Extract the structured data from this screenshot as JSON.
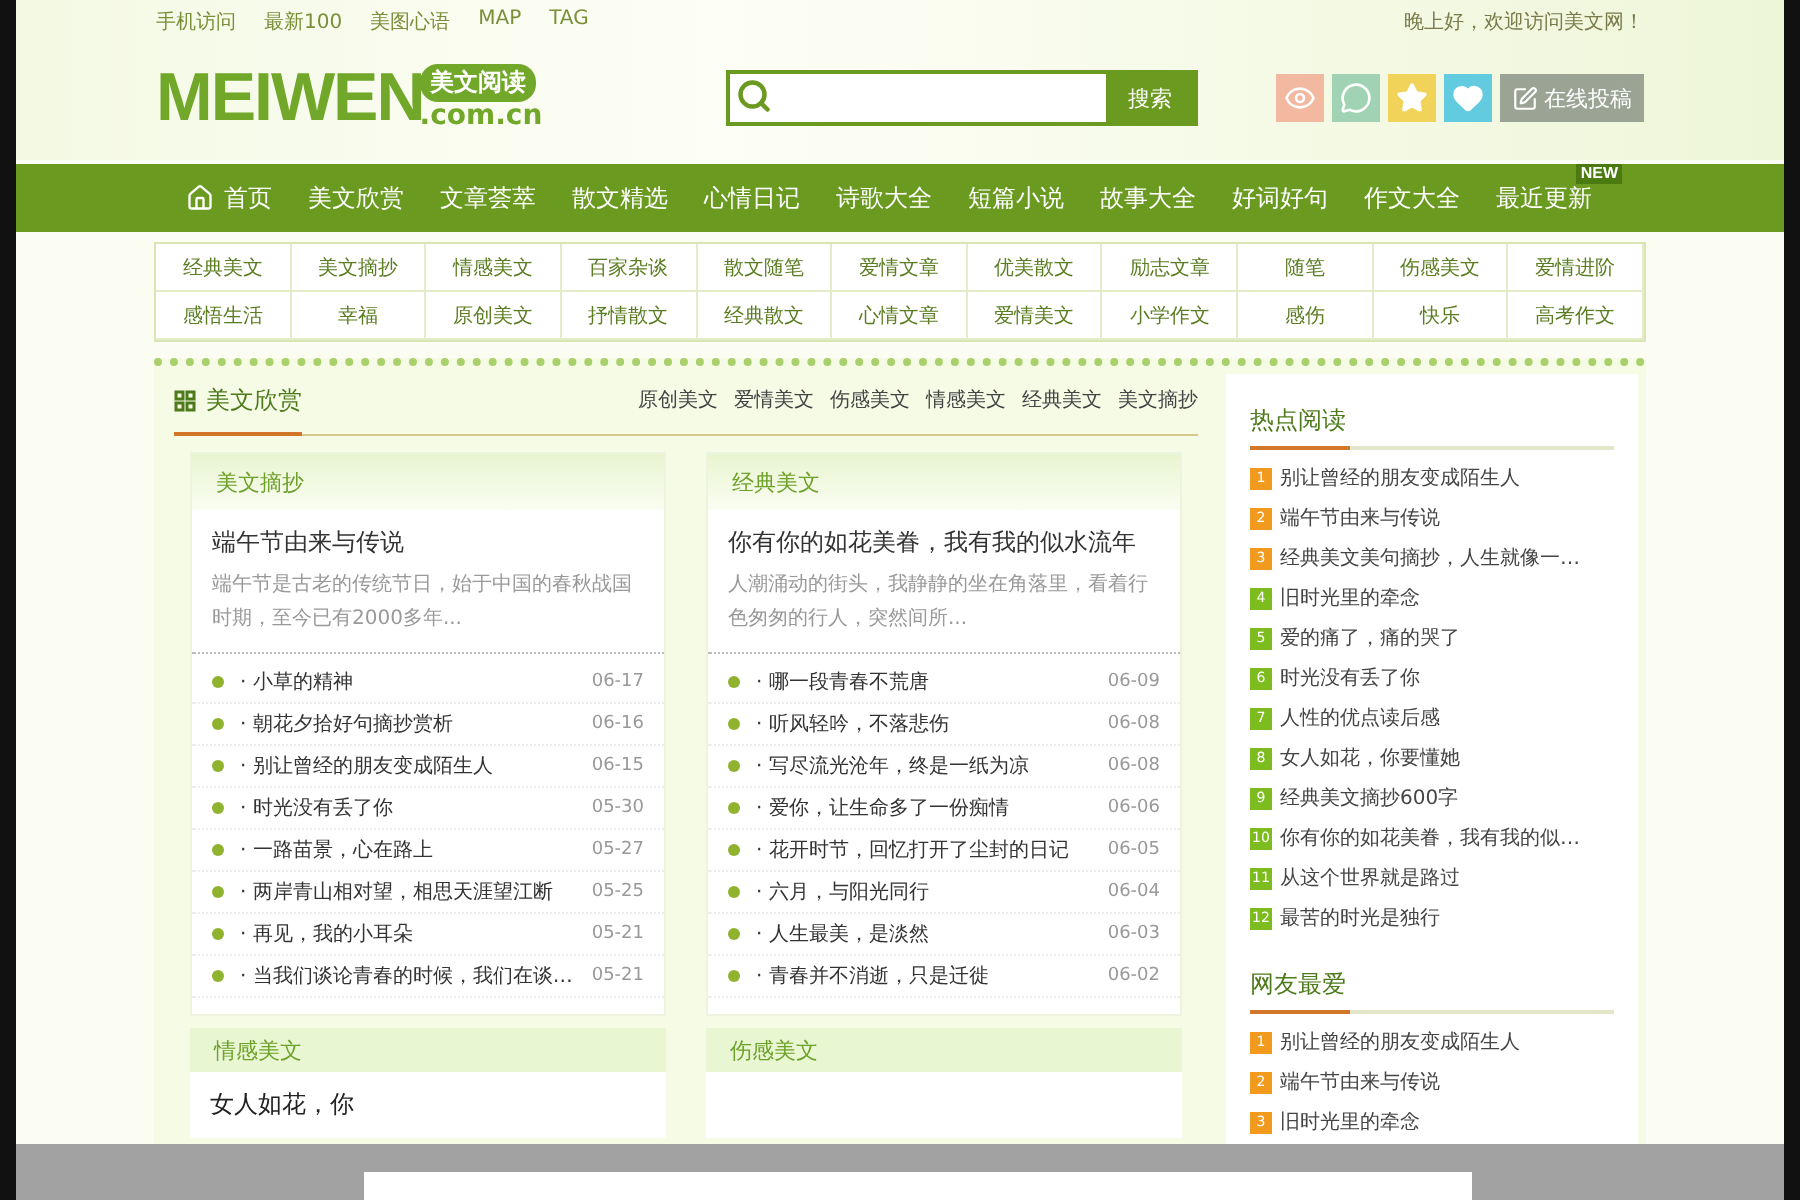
{
  "top_links": [
    "手机访问",
    "最新100",
    "美图心语",
    "MAP",
    "TAG"
  ],
  "greeting": "晚上好，欢迎访问美文网！",
  "logo": {
    "wordmark": "MEIWEN",
    "badge": "美文阅读",
    "domain": ".com.cn"
  },
  "search": {
    "button": "搜索"
  },
  "submit_button": "在线投稿",
  "nav": [
    {
      "label": "首页",
      "kind": "home"
    },
    {
      "label": "美文欣赏",
      "kind": "plain"
    },
    {
      "label": "文章荟萃",
      "kind": "plain"
    },
    {
      "label": "散文精选",
      "kind": "plain"
    },
    {
      "label": "心情日记",
      "kind": "plain"
    },
    {
      "label": "诗歌大全",
      "kind": "plain"
    },
    {
      "label": "短篇小说",
      "kind": "plain"
    },
    {
      "label": "故事大全",
      "kind": "plain"
    },
    {
      "label": "好词好句",
      "kind": "plain"
    },
    {
      "label": "作文大全",
      "kind": "plain"
    },
    {
      "label": "最近更新",
      "kind": "new",
      "badge": "NEW"
    }
  ],
  "categories": [
    [
      "经典美文",
      "美文摘抄",
      "情感美文",
      "百家杂谈",
      "散文随笔",
      "爱情文章",
      "优美散文",
      "励志文章",
      "随笔",
      "伤感美文",
      "爱情进阶"
    ],
    [
      "感悟生活",
      "幸福",
      "原创美文",
      "抒情散文",
      "经典散文",
      "心情文章",
      "爱情美文",
      "小学作文",
      "感伤",
      "快乐",
      "高考作文"
    ]
  ],
  "section": {
    "title": "美文欣赏",
    "tabs": [
      "原创美文",
      "爱情美文",
      "伤感美文",
      "情感美文",
      "经典美文",
      "美文摘抄"
    ]
  },
  "cards": [
    {
      "title": "美文摘抄",
      "lead": "端午节由来与传说",
      "summary": "端午节是古老的传统节日，始于中国的春秋战国时期，至今已有2000多年...",
      "items": [
        {
          "text": "· 小草的精神",
          "date": "06-17"
        },
        {
          "text": "· 朝花夕拾好句摘抄赏析",
          "date": "06-16"
        },
        {
          "text": "· 别让曾经的朋友变成陌生人",
          "date": "06-15"
        },
        {
          "text": "· 时光没有丢了你",
          "date": "05-30"
        },
        {
          "text": "· 一路苗景，心在路上",
          "date": "05-27"
        },
        {
          "text": "· 两岸青山相对望，相思天涯望江断",
          "date": "05-25"
        },
        {
          "text": "· 再见，我的小耳朵",
          "date": "05-21"
        },
        {
          "text": "· 当我们谈论青春的时候，我们在谈…",
          "date": "05-21"
        }
      ]
    },
    {
      "title": "经典美文",
      "lead": "你有你的如花美眷，我有我的似水流年",
      "summary": "人潮涌动的街头，我静静的坐在角落里，看着行色匆匆的行人，突然间所...",
      "items": [
        {
          "text": "· 哪一段青春不荒唐",
          "date": "06-09"
        },
        {
          "text": "· 听风轻吟，不落悲伤",
          "date": "06-08"
        },
        {
          "text": "· 写尽流光沧年，终是一纸为凉",
          "date": "06-08"
        },
        {
          "text": "· 爱你，让生命多了一份痴情",
          "date": "06-06"
        },
        {
          "text": "· 花开时节，回忆打开了尘封的日记",
          "date": "06-05"
        },
        {
          "text": "· 六月，与阳光同行",
          "date": "06-04"
        },
        {
          "text": "· 人生最美，是淡然",
          "date": "06-03"
        },
        {
          "text": "· 青春并不消逝，只是迁徙",
          "date": "06-02"
        }
      ]
    }
  ],
  "lower_cards": [
    {
      "title": "情感美文",
      "lead": "女人如花，你"
    },
    {
      "title": "伤感美文"
    }
  ],
  "sidebar": [
    {
      "title": "热点阅读",
      "items": [
        {
          "rank": "1",
          "text": "别让曾经的朋友变成陌生人",
          "color": "#f29a1d"
        },
        {
          "rank": "2",
          "text": "端午节由来与传说",
          "color": "#f29a1d"
        },
        {
          "rank": "3",
          "text": "经典美文美句摘抄，人生就像一…",
          "color": "#f29a1d"
        },
        {
          "rank": "4",
          "text": "旧时光里的牵念",
          "color": "#7cbc1e"
        },
        {
          "rank": "5",
          "text": "爱的痛了，痛的哭了",
          "color": "#7cbc1e"
        },
        {
          "rank": "6",
          "text": "时光没有丢了你",
          "color": "#7cbc1e"
        },
        {
          "rank": "7",
          "text": "人性的优点读后感",
          "color": "#7cbc1e"
        },
        {
          "rank": "8",
          "text": "女人如花，你要懂她",
          "color": "#7cbc1e"
        },
        {
          "rank": "9",
          "text": "经典美文摘抄600字",
          "color": "#7cbc1e"
        },
        {
          "rank": "10",
          "text": "你有你的如花美眷，我有我的似…",
          "color": "#7cbc1e"
        },
        {
          "rank": "11",
          "text": "从这个世界就是路过",
          "color": "#7cbc1e"
        },
        {
          "rank": "12",
          "text": "最苦的时光是独行",
          "color": "#7cbc1e"
        }
      ]
    },
    {
      "title": "网友最爱",
      "items": [
        {
          "rank": "1",
          "text": "别让曾经的朋友变成陌生人",
          "color": "#f29a1d"
        },
        {
          "rank": "2",
          "text": "端午节由来与传说",
          "color": "#f29a1d"
        },
        {
          "rank": "3",
          "text": "旧时光里的牵念",
          "color": "#f29a1d"
        }
      ]
    }
  ]
}
